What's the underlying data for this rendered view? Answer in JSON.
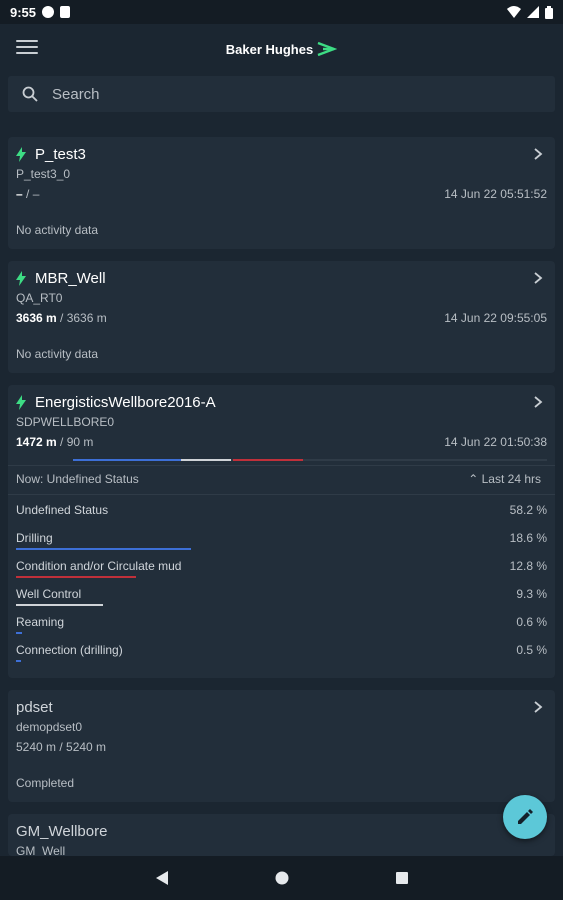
{
  "status_bar": {
    "time": "9:55"
  },
  "app": {
    "brand": "Baker Hughes"
  },
  "search": {
    "placeholder": "Search"
  },
  "colors": {
    "accent_green": "#3ddc84",
    "fab": "#5cc8d8",
    "drilling": "#3d6fd6",
    "condition_mud": "#c0303a",
    "well_control": "#cfd3d7"
  },
  "cards": [
    {
      "title": "P_test3",
      "subtitle": "P_test3_0",
      "depth_current": "–",
      "depth_sep": " / –",
      "date": "14 Jun 22 05:51:52",
      "note": "No activity data",
      "active": true
    },
    {
      "title": "MBR_Well",
      "subtitle": "QA_RT0",
      "depth_current": "3636 m",
      "depth_sep": " / 3636 m",
      "date": "14 Jun 22 09:55:05",
      "note": "No activity data",
      "active": true
    },
    {
      "title": "EnergisticsWellbore2016-A",
      "subtitle": "SDPWELLBORE0",
      "depth_current": "1472 m",
      "depth_sep": " / 90 m",
      "date": "14 Jun 22 01:50:38",
      "active": true,
      "now": "Now: Undefined Status",
      "range": "⌃ Last 24 hrs",
      "activities": [
        {
          "label": "Undefined Status",
          "percent": "58.2 %",
          "fraction": 0.582,
          "color": ""
        },
        {
          "label": "Drilling",
          "percent": "18.6 %",
          "fraction": 0.186,
          "color": "#3d6fd6"
        },
        {
          "label": "Condition and/or Circulate mud",
          "percent": "12.8 %",
          "fraction": 0.128,
          "color": "#c0303a"
        },
        {
          "label": "Well Control",
          "percent": "9.3 %",
          "fraction": 0.093,
          "color": "#cfd3d7"
        },
        {
          "label": "Reaming",
          "percent": "0.6 %",
          "fraction": 0.006,
          "color": "#3d6fd6"
        },
        {
          "label": "Connection (drilling)",
          "percent": "0.5 %",
          "fraction": 0.005,
          "color": "#3d6fd6"
        }
      ]
    },
    {
      "title": "pdset",
      "subtitle": "demopdset0",
      "depth": "5240 m / 5240 m",
      "note": "Completed",
      "active": false
    },
    {
      "title": "GM_Wellbore",
      "subtitle": "GM_Well",
      "active": false
    }
  ]
}
